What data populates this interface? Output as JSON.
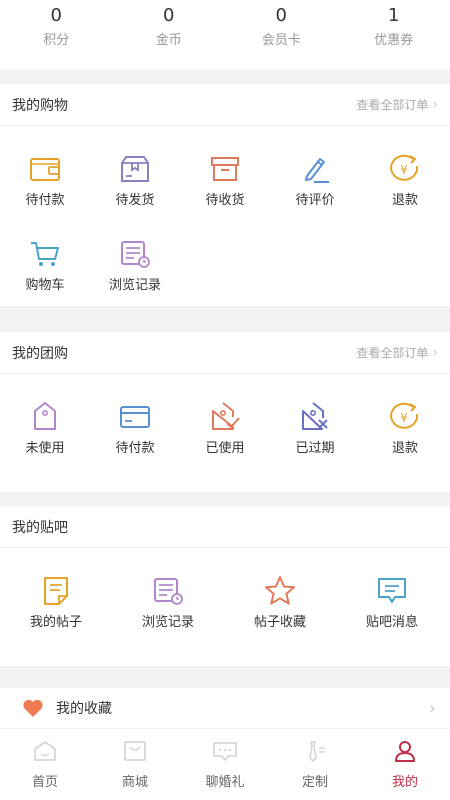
{
  "stats": [
    {
      "value": "0",
      "label": "积分"
    },
    {
      "value": "0",
      "label": "金币"
    },
    {
      "value": "0",
      "label": "会员卡"
    },
    {
      "value": "1",
      "label": "优惠券"
    }
  ],
  "shopping": {
    "title": "我的购物",
    "more": "查看全部订单",
    "items": [
      "待付款",
      "待发货",
      "待收货",
      "待评价",
      "退款",
      "购物车",
      "浏览记录"
    ]
  },
  "group": {
    "title": "我的团购",
    "more": "查看全部订单",
    "items": [
      "未使用",
      "待付款",
      "已使用",
      "已过期",
      "退款"
    ]
  },
  "tieba": {
    "title": "我的贴吧",
    "items": [
      "我的帖子",
      "浏览记录",
      "帖子收藏",
      "贴吧消息"
    ]
  },
  "favorites": {
    "title": "我的收藏"
  },
  "tabs": [
    "首页",
    "商城",
    "聊婚礼",
    "定制",
    "我的"
  ],
  "colors": {
    "active_tab": "#c0304a",
    "heart": "#f07b52"
  }
}
